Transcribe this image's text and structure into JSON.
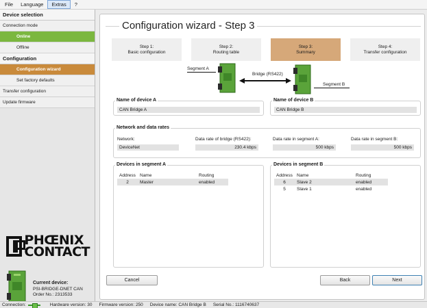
{
  "menubar": {
    "items": [
      {
        "label": "File"
      },
      {
        "label": "Language"
      },
      {
        "label": "Extras"
      },
      {
        "label": "?"
      }
    ]
  },
  "sidebar": {
    "device_selection": "Device selection",
    "connection_mode": "Connection mode",
    "online": "Online",
    "offline": "Offline",
    "configuration": "Configuration",
    "configuration_wizard": "Configuration wizard",
    "set_factory_defaults": "Set factory defaults",
    "transfer_configuration": "Transfer configuration",
    "update_firmware": "Update firmware"
  },
  "logo": {
    "line1": "PHŒNIX",
    "line2": "CONTACT"
  },
  "current_device": {
    "title": "Current device:",
    "model": "PSI-BRIDGE-DNET CAN",
    "order": "Order No.:  2313533"
  },
  "wizard": {
    "title": "Configuration wizard - Step 3",
    "steps": [
      {
        "line1": "Step 1:",
        "line2": "Basic configuration"
      },
      {
        "line1": "Step 2:",
        "line2": "Routing table"
      },
      {
        "line1": "Step 3:",
        "line2": "Summary"
      },
      {
        "line1": "Step 4:",
        "line2": "Transfer configuration"
      }
    ]
  },
  "diagram": {
    "segment_a": "Segment A",
    "segment_b": "Segment B",
    "bridge": "Bridge (RS422)"
  },
  "device_a": {
    "title": "Name of device A",
    "value": "CAN Bridge A"
  },
  "device_b": {
    "title": "Name of device B",
    "value": "CAN Bridge B"
  },
  "network": {
    "title": "Network and data rates",
    "network_label": "Network:",
    "network_value": "DeviceNet",
    "bridge_rate_label": "Data rate of bridge (RS422):",
    "bridge_rate_value": "230.4 kbps",
    "seg_a_label": "Data rate in segment A:",
    "seg_a_value": "500 kbps",
    "seg_b_label": "Data rate in segment B:",
    "seg_b_value": "500 kbps"
  },
  "segment_a_devices": {
    "title": "Devices in segment A",
    "columns": [
      "Address",
      "Name",
      "Routing"
    ],
    "rows": [
      {
        "address": "2",
        "name": "Master",
        "routing": "enabled"
      }
    ]
  },
  "segment_b_devices": {
    "title": "Devices in segment B",
    "columns": [
      "Address",
      "Name",
      "Routing"
    ],
    "rows": [
      {
        "address": "6",
        "name": "Slave 2",
        "routing": "enabled"
      },
      {
        "address": "5",
        "name": "Slave 1",
        "routing": "enabled"
      }
    ]
  },
  "buttons": {
    "cancel": "Cancel",
    "back": "Back",
    "next": "Next"
  },
  "statusbar": {
    "connection": "Connection:",
    "hardware": "Hardware version:  30",
    "firmware": "Firmware version:  250",
    "device_name": "Device name:  CAN Bridge B",
    "serial": "Serial No.:  1116740637"
  },
  "colors": {
    "online_green": "#7bb73f",
    "wizard_orange": "#c98a3b",
    "active_step": "#d6a879"
  }
}
